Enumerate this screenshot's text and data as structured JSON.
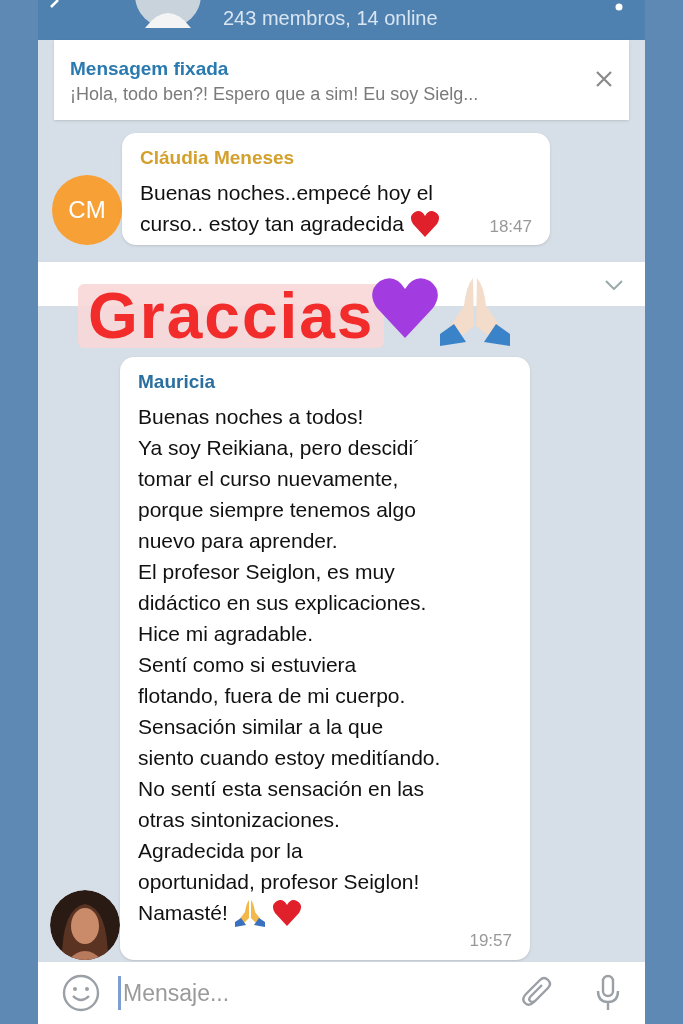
{
  "header": {
    "subtitle": "243 membros, 14 online"
  },
  "pinned": {
    "title": "Mensagem fixada",
    "text": "¡Hola, todo ben?! Espero que a sim!  Eu soy Sielg..."
  },
  "messages": [
    {
      "avatar": {
        "kind": "initials",
        "initials": "CM",
        "color": "#f7a035"
      },
      "sender": "Cláudia Meneses",
      "lines": [
        "Buenas noches..empecé hoy el",
        "curso.. estoy tan agradecida"
      ],
      "emojis": [
        {
          "kind": "heart"
        }
      ],
      "time": "18:47"
    },
    {
      "sender": "Mauricia",
      "lines": [
        "Buenas noches a todos!",
        "Ya soy Reikiana, pero descidi´",
        "tomar el curso nuevamente,",
        "porque siempre tenemos algo",
        "nuevo para aprender.",
        "El profesor Seiglon, es muy",
        "didáctico en sus explicaciones.",
        "Hice mi agradable.",
        "Sentí como si estuviera",
        "flotando, fuera de mi cuerpo.",
        "Sensación similar a la que",
        "siento cuando estoy meditíando.",
        "No sentí esta sensación en las",
        "otras sintonizaciones.",
        "Agradecida por la",
        "oportunidad, profesor Seiglon!",
        "Namasté!"
      ],
      "emojis": [
        {
          "kind": "pray"
        },
        {
          "kind": "heart"
        }
      ],
      "time": "19:57"
    }
  ],
  "overlay": {
    "text": "Graccias"
  },
  "composer": {
    "placeholder": "Mensaje..."
  }
}
